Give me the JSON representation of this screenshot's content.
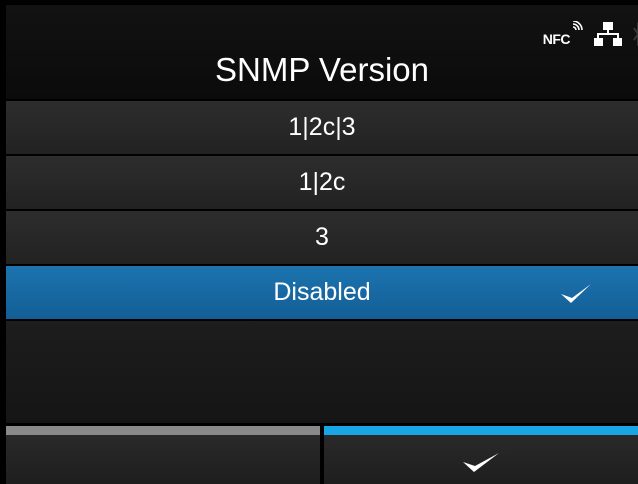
{
  "header": {
    "title": "SNMP Version",
    "status_icons": {
      "nfc_label": "NFC",
      "nfc": "nfc-icon",
      "network": "network-icon",
      "bluetooth": "bluetooth-icon"
    }
  },
  "options": [
    {
      "label": "1|2c|3",
      "selected": false
    },
    {
      "label": "1|2c",
      "selected": false
    },
    {
      "label": "3",
      "selected": false
    },
    {
      "label": "Disabled",
      "selected": true
    }
  ],
  "colors": {
    "selected_row": "#1c6ea8",
    "confirm_accent": "#19a6e6",
    "back_accent": "#8a8a8a"
  },
  "soft_buttons": {
    "left": {
      "icon": "none"
    },
    "right": {
      "icon": "checkmark-icon"
    }
  }
}
